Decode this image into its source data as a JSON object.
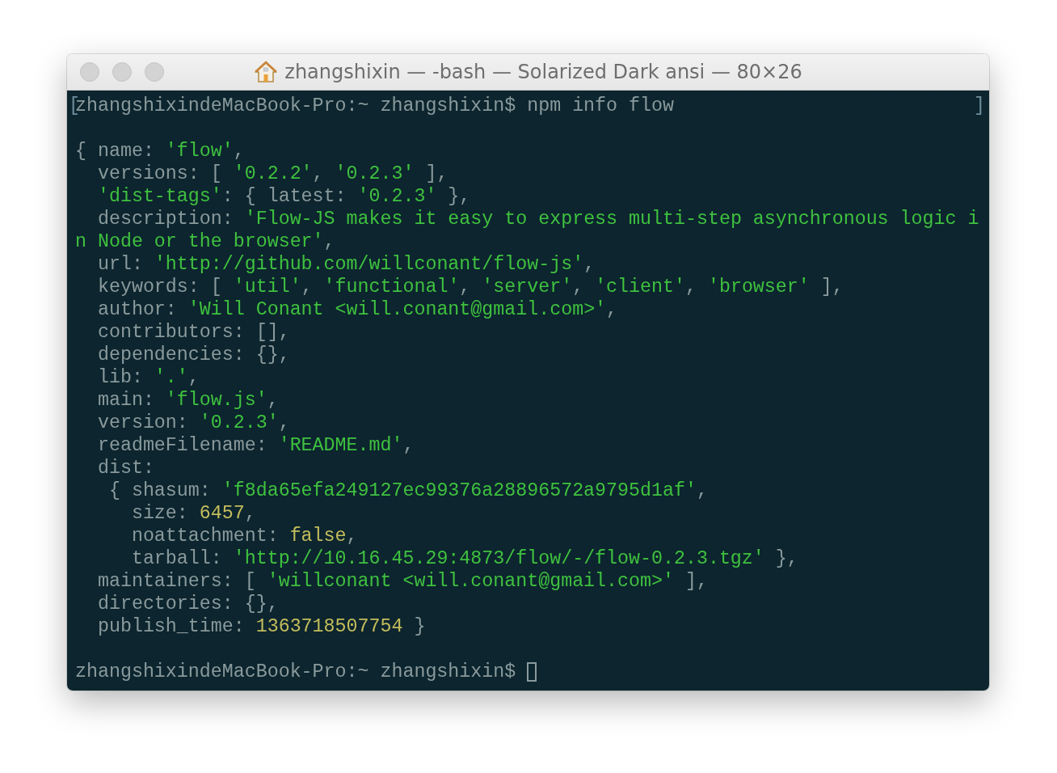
{
  "window": {
    "title": "zhangshixin — -bash — Solarized Dark ansi — 80×26"
  },
  "lines": [
    {
      "kind": "prompt",
      "mark": "[",
      "segments": [
        {
          "kind": "plain",
          "text": "zhangshixindeMacBook-Pro:~ zhangshixin$ npm info flow"
        }
      ],
      "end_mark": "]",
      "cursor": false
    },
    {
      "kind": "blank",
      "cursor": false
    },
    {
      "kind": "output",
      "segments": [
        {
          "kind": "plain",
          "text": "{ name: "
        },
        {
          "kind": "string",
          "text": "'flow'"
        },
        {
          "kind": "plain",
          "text": ","
        }
      ],
      "cursor": false
    },
    {
      "kind": "output",
      "segments": [
        {
          "kind": "plain",
          "text": "  versions: [ "
        },
        {
          "kind": "string",
          "text": "'0.2.2'"
        },
        {
          "kind": "plain",
          "text": ", "
        },
        {
          "kind": "string",
          "text": "'0.2.3'"
        },
        {
          "kind": "plain",
          "text": " ],"
        }
      ],
      "cursor": false
    },
    {
      "kind": "output",
      "segments": [
        {
          "kind": "string",
          "text": "  'dist-tags'"
        },
        {
          "kind": "plain",
          "text": ": { latest: "
        },
        {
          "kind": "string",
          "text": "'0.2.3'"
        },
        {
          "kind": "plain",
          "text": " },"
        }
      ],
      "cursor": false
    },
    {
      "kind": "output",
      "segments": [
        {
          "kind": "plain",
          "text": "  description: "
        },
        {
          "kind": "string",
          "text": "'Flow-JS makes it easy to express multi-step asynchronous logic i"
        }
      ],
      "cursor": false
    },
    {
      "kind": "output",
      "segments": [
        {
          "kind": "string",
          "text": "n Node or the browser'"
        },
        {
          "kind": "plain",
          "text": ","
        }
      ],
      "cursor": false
    },
    {
      "kind": "output",
      "segments": [
        {
          "kind": "plain",
          "text": "  url: "
        },
        {
          "kind": "string",
          "text": "'http://github.com/willconant/flow-js'"
        },
        {
          "kind": "plain",
          "text": ","
        }
      ],
      "cursor": false
    },
    {
      "kind": "output",
      "segments": [
        {
          "kind": "plain",
          "text": "  keywords: [ "
        },
        {
          "kind": "string",
          "text": "'util'"
        },
        {
          "kind": "plain",
          "text": ", "
        },
        {
          "kind": "string",
          "text": "'functional'"
        },
        {
          "kind": "plain",
          "text": ", "
        },
        {
          "kind": "string",
          "text": "'server'"
        },
        {
          "kind": "plain",
          "text": ", "
        },
        {
          "kind": "string",
          "text": "'client'"
        },
        {
          "kind": "plain",
          "text": ", "
        },
        {
          "kind": "string",
          "text": "'browser'"
        },
        {
          "kind": "plain",
          "text": " ],"
        }
      ],
      "cursor": false
    },
    {
      "kind": "output",
      "segments": [
        {
          "kind": "plain",
          "text": "  author: "
        },
        {
          "kind": "string",
          "text": "'Will Conant <will.conant@gmail.com>'"
        },
        {
          "kind": "plain",
          "text": ","
        }
      ],
      "cursor": false
    },
    {
      "kind": "output",
      "segments": [
        {
          "kind": "plain",
          "text": "  contributors: [],"
        }
      ],
      "cursor": false
    },
    {
      "kind": "output",
      "segments": [
        {
          "kind": "plain",
          "text": "  dependencies: {},"
        }
      ],
      "cursor": false
    },
    {
      "kind": "output",
      "segments": [
        {
          "kind": "plain",
          "text": "  lib: "
        },
        {
          "kind": "string",
          "text": "'.'"
        },
        {
          "kind": "plain",
          "text": ","
        }
      ],
      "cursor": false
    },
    {
      "kind": "output",
      "segments": [
        {
          "kind": "plain",
          "text": "  main: "
        },
        {
          "kind": "string",
          "text": "'flow.js'"
        },
        {
          "kind": "plain",
          "text": ","
        }
      ],
      "cursor": false
    },
    {
      "kind": "output",
      "segments": [
        {
          "kind": "plain",
          "text": "  version: "
        },
        {
          "kind": "string",
          "text": "'0.2.3'"
        },
        {
          "kind": "plain",
          "text": ","
        }
      ],
      "cursor": false
    },
    {
      "kind": "output",
      "segments": [
        {
          "kind": "plain",
          "text": "  readmeFilename: "
        },
        {
          "kind": "string",
          "text": "'README.md'"
        },
        {
          "kind": "plain",
          "text": ","
        }
      ],
      "cursor": false
    },
    {
      "kind": "output",
      "segments": [
        {
          "kind": "plain",
          "text": "  dist:"
        }
      ],
      "cursor": false
    },
    {
      "kind": "output",
      "segments": [
        {
          "kind": "plain",
          "text": "   { shasum: "
        },
        {
          "kind": "string",
          "text": "'f8da65efa249127ec99376a28896572a9795d1af'"
        },
        {
          "kind": "plain",
          "text": ","
        }
      ],
      "cursor": false
    },
    {
      "kind": "output",
      "segments": [
        {
          "kind": "plain",
          "text": "     size: "
        },
        {
          "kind": "number",
          "text": "6457"
        },
        {
          "kind": "plain",
          "text": ","
        }
      ],
      "cursor": false
    },
    {
      "kind": "output",
      "segments": [
        {
          "kind": "plain",
          "text": "     noattachment: "
        },
        {
          "kind": "boolean",
          "text": "false"
        },
        {
          "kind": "plain",
          "text": ","
        }
      ],
      "cursor": false
    },
    {
      "kind": "output",
      "segments": [
        {
          "kind": "plain",
          "text": "     tarball: "
        },
        {
          "kind": "string",
          "text": "'http://10.16.45.29:4873/flow/-/flow-0.2.3.tgz'"
        },
        {
          "kind": "plain",
          "text": " },"
        }
      ],
      "cursor": false
    },
    {
      "kind": "output",
      "segments": [
        {
          "kind": "plain",
          "text": "  maintainers: [ "
        },
        {
          "kind": "string",
          "text": "'willconant <will.conant@gmail.com>'"
        },
        {
          "kind": "plain",
          "text": " ],"
        }
      ],
      "cursor": false
    },
    {
      "kind": "output",
      "segments": [
        {
          "kind": "plain",
          "text": "  directories: {},"
        }
      ],
      "cursor": false
    },
    {
      "kind": "output",
      "segments": [
        {
          "kind": "plain",
          "text": "  publish_time: "
        },
        {
          "kind": "number",
          "text": "1363718507754"
        },
        {
          "kind": "plain",
          "text": " }"
        }
      ],
      "cursor": false
    },
    {
      "kind": "blank",
      "cursor": false
    },
    {
      "kind": "prompt",
      "segments": [
        {
          "kind": "plain",
          "text": "zhangshixindeMacBook-Pro:~ zhangshixin$ "
        }
      ],
      "cursor": true
    }
  ]
}
